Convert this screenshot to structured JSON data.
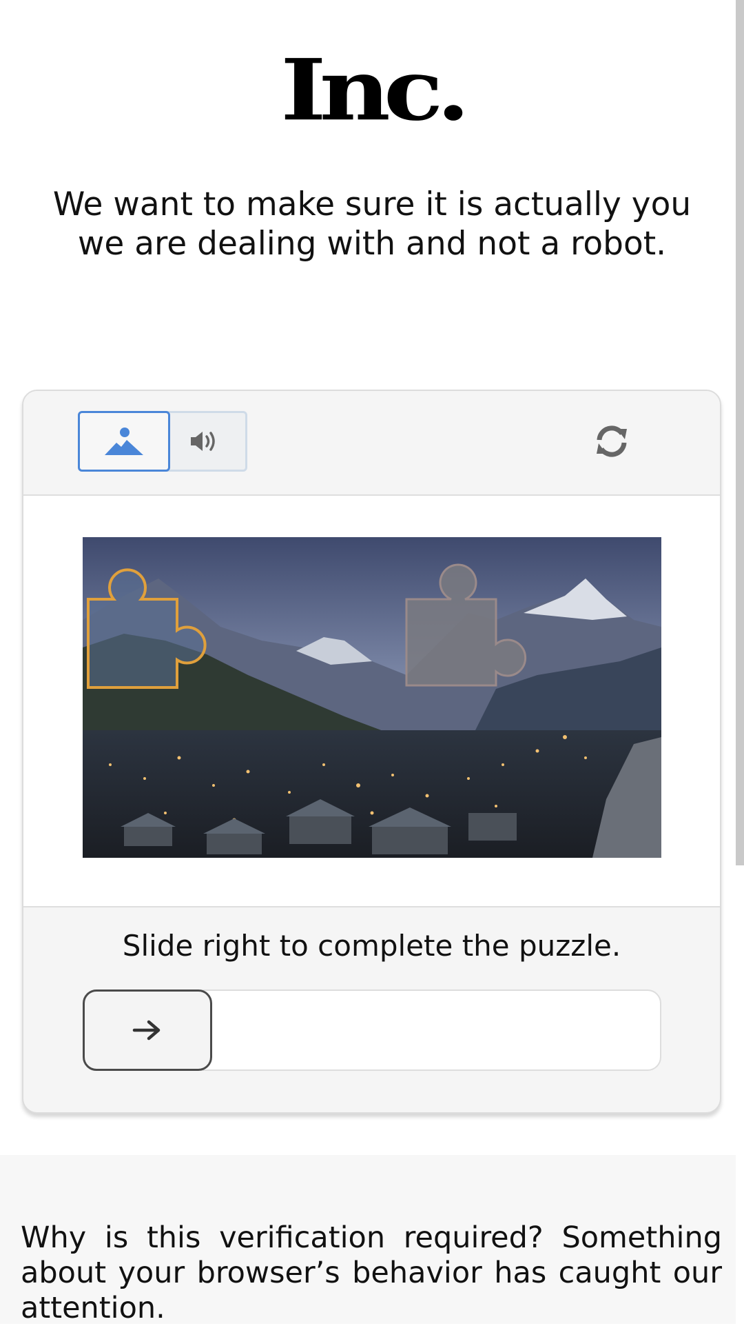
{
  "brand": {
    "logo_text": "Inc."
  },
  "headline": "We want to make sure it is actually you we are dealing with and not a robot.",
  "captcha": {
    "modes": [
      {
        "name": "image",
        "icon": "landscape-icon",
        "selected": true
      },
      {
        "name": "audio",
        "icon": "speaker-icon",
        "selected": false
      }
    ],
    "refresh_icon": "refresh-icon",
    "puzzle_image": "mountain-village-dusk",
    "prompt": "Slide right to complete the puzzle.",
    "slider": {
      "icon": "arrow-right-icon",
      "progress": 0
    },
    "colors": {
      "selected_border": "#4a86d8",
      "piece_outline": "#e0a03c"
    }
  },
  "footer": {
    "text": "Why is this verification required? Something about your browser’s behavior has caught our attention."
  }
}
